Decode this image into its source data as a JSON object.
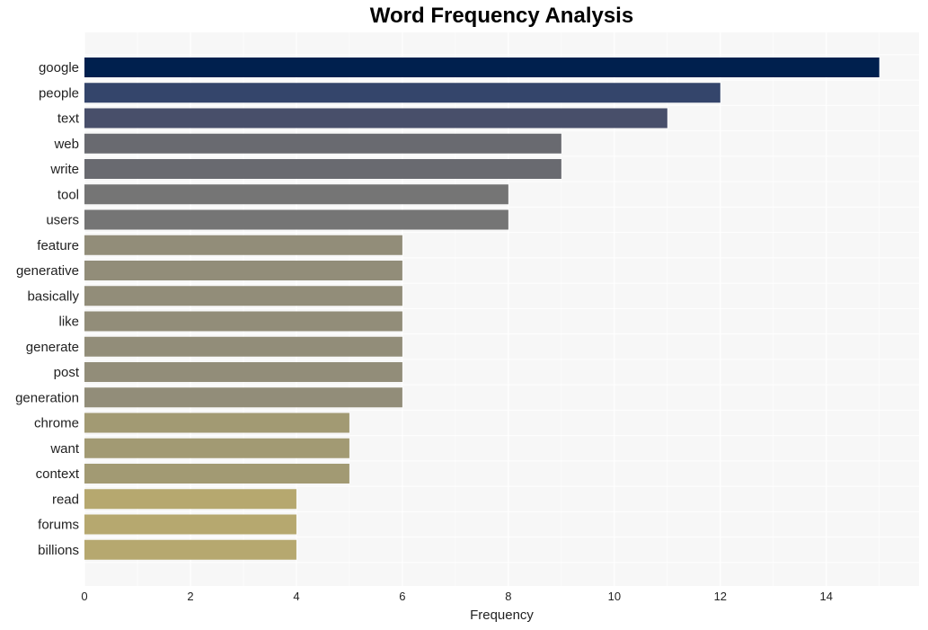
{
  "chart_data": {
    "type": "bar",
    "orientation": "horizontal",
    "title": "Word Frequency Analysis",
    "xlabel": "Frequency",
    "ylabel": "",
    "xlim": [
      0,
      15.75
    ],
    "xticks": [
      0,
      2,
      4,
      6,
      8,
      10,
      12,
      14
    ],
    "grid": true,
    "categories": [
      "google",
      "people",
      "text",
      "web",
      "write",
      "tool",
      "users",
      "feature",
      "generative",
      "basically",
      "like",
      "generate",
      "post",
      "generation",
      "chrome",
      "want",
      "context",
      "read",
      "forums",
      "billions"
    ],
    "values": [
      15,
      12,
      11,
      9,
      9,
      8,
      8,
      6,
      6,
      6,
      6,
      6,
      6,
      6,
      5,
      5,
      5,
      4,
      4,
      4
    ],
    "colors": [
      "#00204e",
      "#34456b",
      "#484f6a",
      "#696a70",
      "#696a70",
      "#757575",
      "#757575",
      "#928d79",
      "#928d79",
      "#928d79",
      "#928d79",
      "#928d79",
      "#928d79",
      "#928d79",
      "#a29a73",
      "#a29a73",
      "#a29a73",
      "#b6a86f",
      "#b6a86f",
      "#b6a86f"
    ],
    "background": "#f7f7f7"
  }
}
